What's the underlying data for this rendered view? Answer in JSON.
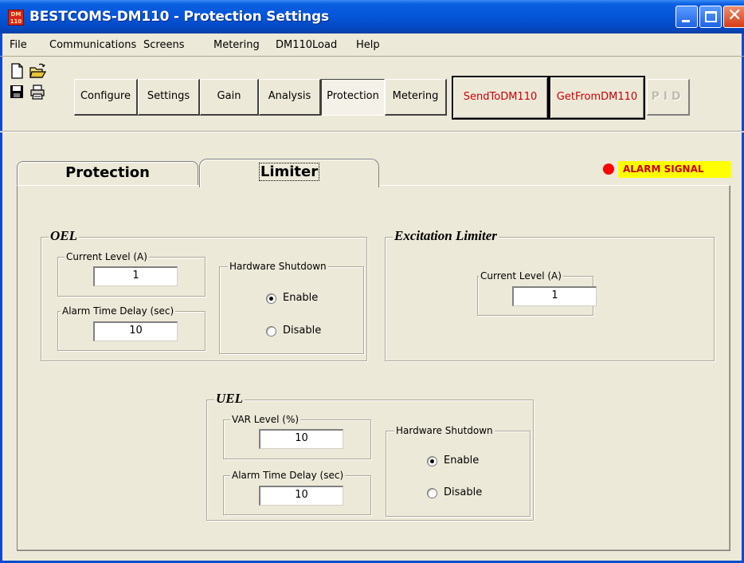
{
  "window": {
    "title": "BESTCOMS-DM110 - Protection Settings",
    "icon_text": "DM 110",
    "title_bar_color": "#0555d8"
  },
  "menu": {
    "items": [
      "File",
      "Communications",
      "Screens",
      "Metering",
      "DM110Load",
      "Help"
    ]
  },
  "toolbar": {
    "icons": [
      "new-file-icon",
      "open-folder-icon",
      "save-disk-icon",
      "print-icon"
    ],
    "nav_buttons": [
      "Configure",
      "Settings",
      "Gain",
      "Analysis",
      "Protection",
      "Metering"
    ],
    "active_nav": "Protection",
    "send_label": "SendToDM110",
    "get_label": "GetFromDM110",
    "pid_label": "PID",
    "action_color": "#c8000a"
  },
  "tabs": {
    "protection_label": "Protection",
    "limiter_label": "Limiter",
    "active": "Limiter"
  },
  "alarm": {
    "label": "ALARM SIGNAL",
    "dot_color": "#ff0000",
    "bg_color": "#ffff00"
  },
  "oel": {
    "title": "OEL",
    "current_level_label": "Current Level (A)",
    "current_level_value": "1",
    "alarm_delay_label": "Alarm Time Delay (sec)",
    "alarm_delay_value": "10",
    "hw_shutdown_label": "Hardware Shutdown",
    "enable_label": "Enable",
    "disable_label": "Disable",
    "hw_shutdown_selected": "Enable"
  },
  "excitation_limiter": {
    "title": "Excitation Limiter",
    "current_level_label": "Current Level (A)",
    "current_level_value": "1"
  },
  "uel": {
    "title": "UEL",
    "var_level_label": "VAR Level (%)",
    "var_level_value": "10",
    "alarm_delay_label": "Alarm Time Delay (sec)",
    "alarm_delay_value": "10",
    "hw_shutdown_label": "Hardware Shutdown",
    "enable_label": "Enable",
    "disable_label": "Disable",
    "hw_shutdown_selected": "Enable"
  }
}
